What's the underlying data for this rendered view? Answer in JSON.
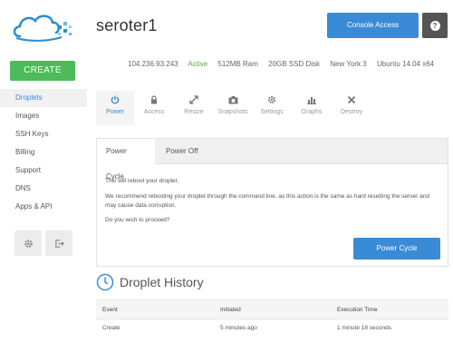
{
  "sidebar": {
    "create_label": "CREATE",
    "items": [
      {
        "label": "Droplets",
        "active": true
      },
      {
        "label": "Images"
      },
      {
        "label": "SSH Keys"
      },
      {
        "label": "Billing"
      },
      {
        "label": "Support"
      },
      {
        "label": "DNS"
      },
      {
        "label": "Apps & API"
      }
    ],
    "tools": [
      {
        "icon": "gear-icon"
      },
      {
        "icon": "logout-icon"
      }
    ]
  },
  "header": {
    "droplet_name": "seroter1",
    "console_label": "Console Access",
    "help_glyph": "?"
  },
  "info": {
    "ip": "104.236.93.243",
    "status": "Active",
    "ram": "512MB Ram",
    "disk": "20GB SSD Disk",
    "region": "New York 3",
    "os": "Ubuntu 14.04 x64"
  },
  "actions": [
    {
      "label": "Power",
      "icon": "power-icon",
      "active": true
    },
    {
      "label": "Access",
      "icon": "lock-icon"
    },
    {
      "label": "Resize",
      "icon": "resize-icon"
    },
    {
      "label": "Snapshots",
      "icon": "camera-icon"
    },
    {
      "label": "Settings",
      "icon": "gear-icon"
    },
    {
      "label": "Graphs",
      "icon": "bar-chart-icon"
    },
    {
      "label": "Destroy",
      "icon": "close-icon"
    }
  ],
  "panel": {
    "tabs": [
      {
        "label": "Power Cycle",
        "active": true
      },
      {
        "label": "Power Off"
      }
    ],
    "line1": "This will reboot your droplet.",
    "line2": "We recommend rebooting your droplet through the command line, as this action is the same as hard resetting the server and may cause data corruption.",
    "line3": "Do you wish to proceed?",
    "button_label": "Power Cycle"
  },
  "history": {
    "title": "Droplet History",
    "columns": [
      "Event",
      "Initiated",
      "Execution Time"
    ],
    "rows": [
      [
        "Create",
        "5 minutes ago",
        "1 minute 18 seconds"
      ]
    ]
  },
  "colors": {
    "accent": "#3a8bd7",
    "create": "#4cbb59",
    "status_active": "#5fa640"
  }
}
